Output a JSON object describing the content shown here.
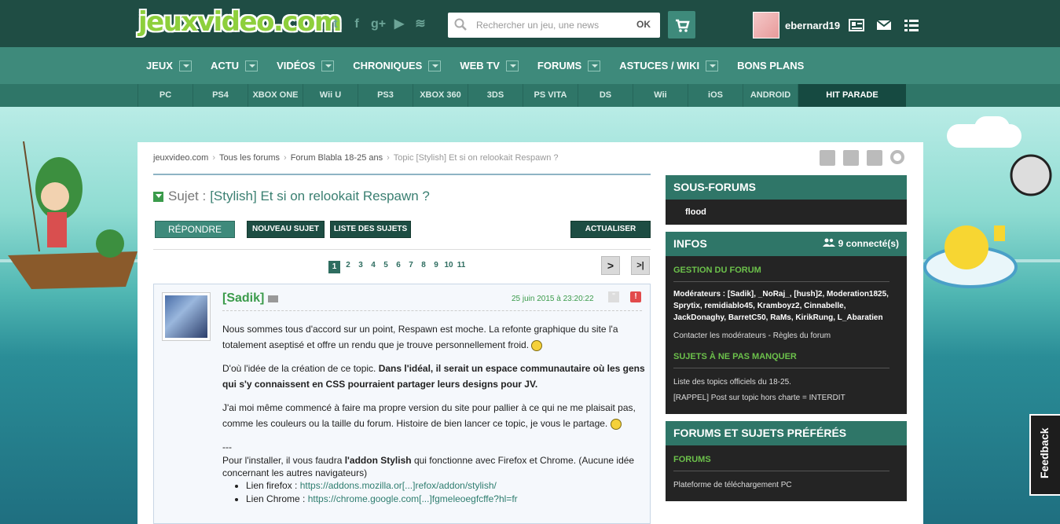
{
  "header": {
    "logo": "jeuxvideo.com",
    "search_placeholder": "Rechercher un jeu, une news",
    "search_ok": "OK",
    "username": "ebernard19"
  },
  "mainnav": [
    {
      "label": "JEUX",
      "dropdown": true
    },
    {
      "label": "ACTU",
      "dropdown": true
    },
    {
      "label": "VIDÉOS",
      "dropdown": true
    },
    {
      "label": "CHRONIQUES",
      "dropdown": true
    },
    {
      "label": "WEB TV",
      "dropdown": true
    },
    {
      "label": "FORUMS",
      "dropdown": true
    },
    {
      "label": "ASTUCES / WIKI",
      "dropdown": true
    },
    {
      "label": "BONS PLANS",
      "dropdown": false
    }
  ],
  "platforms": [
    "PC",
    "PS4",
    "XBOX ONE",
    "Wii U",
    "PS3",
    "XBOX 360",
    "3DS",
    "PS VITA",
    "DS",
    "Wii",
    "iOS",
    "ANDROID",
    "HIT PARADE"
  ],
  "breadcrumb": [
    "jeuxvideo.com",
    "Tous les forums",
    "Forum Blabla 18-25 ans",
    "Topic [Stylish] Et si on relookait Respawn ?"
  ],
  "topic": {
    "subject_label": "Sujet :",
    "title": "[Stylish] Et si on relookait Respawn ?"
  },
  "buttons": {
    "reply": "RÉPONDRE",
    "new_subject": "NOUVEAU SUJET",
    "subject_list": "LISTE DES SUJETS",
    "refresh": "ACTUALISER"
  },
  "pagination": {
    "current": "1",
    "pages": [
      "2",
      "3",
      "4",
      "5",
      "6",
      "7",
      "8",
      "9",
      "10",
      "11"
    ],
    "next": ">",
    "last": ">|"
  },
  "post": {
    "author": "[Sadik]",
    "date": "25 juin 2015 à 23:20:22",
    "p1": "Nous sommes tous d'accord sur un point, Respawn est moche. La refonte graphique du site l'a totalement aseptisé et offre un rendu que je trouve personnellement froid.",
    "p2a": "D'où l'idée de la création de ce topic.",
    "p2b": "Dans l'idéal, il serait un espace communautaire où les gens qui s'y connaissent en CSS pourraient partager leurs designs pour JV.",
    "p3": "J'ai moi même commencé à faire ma propre version du site pour pallier à ce qui ne me plaisait pas, comme les couleurs ou la taille du forum. Histoire de bien lancer ce topic, je vous le partage.",
    "sep": "---",
    "p4a": "Pour l'installer, il vous faudra",
    "p4b": "l'addon Stylish",
    "p4c": "qui fonctionne avec Firefox et Chrome. (Aucune idée concernant les autres navigateurs)",
    "links": [
      {
        "label": "Lien firefox :",
        "url": "https://addons.mozilla.or[...]refox/addon/stylish/"
      },
      {
        "label": "Lien Chrome :",
        "url": "https://chrome.google.com[...]fgmeleoegfcffe?hl=fr"
      }
    ]
  },
  "sidebar": {
    "sousforums": {
      "title": "SOUS-FORUMS",
      "items": [
        "flood"
      ]
    },
    "infos": {
      "title": "INFOS",
      "connected": "9 connecté(s)",
      "gestion_title": "GESTION DU FORUM",
      "moderators": "Modérateurs : [Sadik], _NoRaj_, [hush]2, Moderation1825, Sprytix, remidiablo45, Kramboyz2, Cinnabelle, JackDonaghy, BarretC50, RaMs, KirikRung, L_Abaratien",
      "contact": "Contacter les modérateurs - Règles du forum",
      "ne_pas_manquer_title": "SUJETS À NE PAS MANQUER",
      "topics": [
        "Liste des topics officiels du 18-25.",
        "[RAPPEL] Post sur topic hors charte = INTERDIT"
      ]
    },
    "favoris": {
      "title": "FORUMS ET SUJETS PRÉFÉRÉS",
      "forums_title": "FORUMS",
      "items": [
        "Plateforme de téléchargement PC"
      ]
    }
  },
  "feedback": "Feedback",
  "colors": {
    "header_dark": "#1f4d44",
    "nav": "#3e8a7b",
    "accent_green": "#3b9b4b",
    "sidebar_bg": "#242424"
  }
}
